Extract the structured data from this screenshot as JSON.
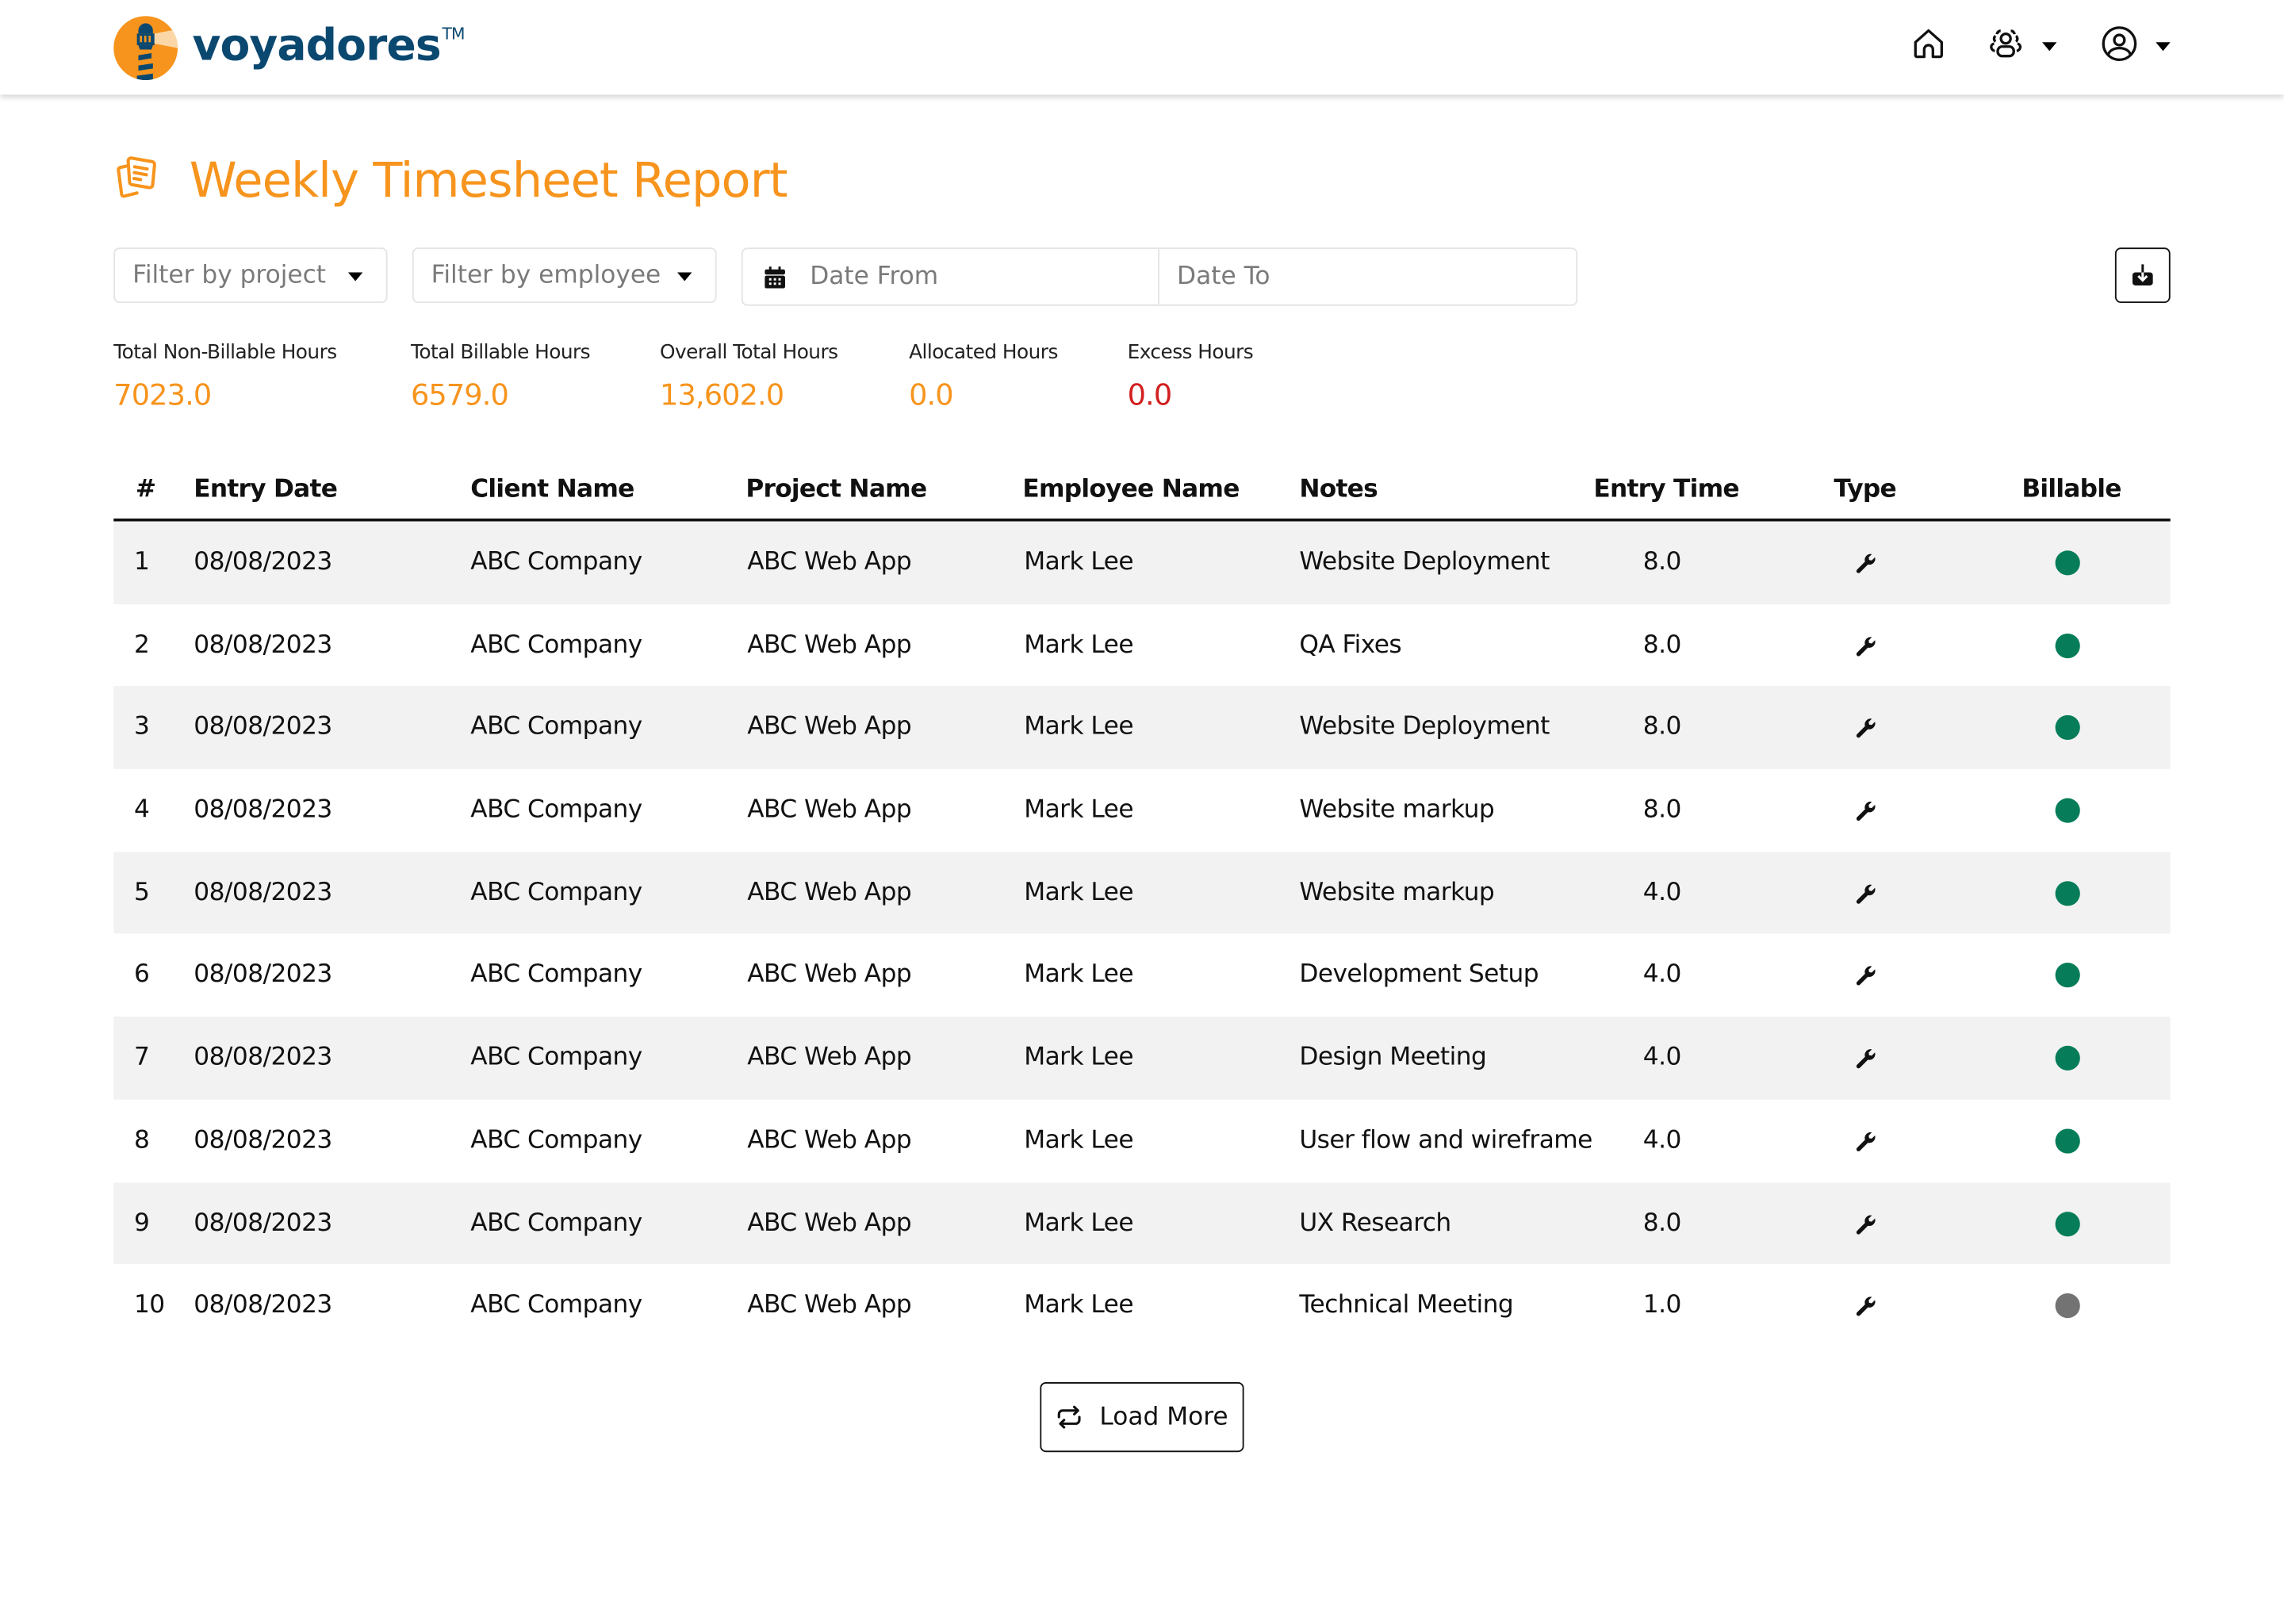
{
  "brand": {
    "name": "voyadores",
    "trademark": "TM",
    "primary_color": "#f7941d",
    "text_color": "#0b4870"
  },
  "nav": {
    "home_icon": "home-icon",
    "team_icon": "users-icon",
    "profile_icon": "user-circle-icon"
  },
  "page": {
    "title": "Weekly Timesheet Report",
    "title_icon": "documents-icon"
  },
  "filters": {
    "project_placeholder": "Filter by project",
    "employee_placeholder": "Filter by employee",
    "date_from_placeholder": "Date From",
    "date_to_placeholder": "Date To",
    "download_icon": "download-icon"
  },
  "stats": [
    {
      "label": "Total Non-Billable Hours",
      "value": "7023.0"
    },
    {
      "label": "Total Billable Hours",
      "value": "6579.0"
    },
    {
      "label": "Overall Total Hours",
      "value": "13,602.0"
    },
    {
      "label": "Allocated Hours",
      "value": "0.0"
    },
    {
      "label": "Excess Hours",
      "value": "0.0",
      "color": "#d21f1f"
    }
  ],
  "table": {
    "columns": [
      "#",
      "Entry Date",
      "Client Name",
      "Project Name",
      "Employee Name",
      "Notes",
      "Entry Time",
      "Type",
      "Billable"
    ],
    "rows": [
      {
        "num": "1",
        "date": "08/08/2023",
        "client": "ABC Company",
        "project": "ABC Web App",
        "employee": "Mark Lee",
        "notes": "Website Deployment",
        "time": "8.0",
        "type": "wrench-icon",
        "billable": true
      },
      {
        "num": "2",
        "date": "08/08/2023",
        "client": "ABC Company",
        "project": "ABC Web App",
        "employee": "Mark Lee",
        "notes": "QA Fixes",
        "time": "8.0",
        "type": "wrench-icon",
        "billable": true
      },
      {
        "num": "3",
        "date": "08/08/2023",
        "client": "ABC Company",
        "project": "ABC Web App",
        "employee": "Mark Lee",
        "notes": "Website Deployment",
        "time": "8.0",
        "type": "wrench-icon",
        "billable": true
      },
      {
        "num": "4",
        "date": "08/08/2023",
        "client": "ABC Company",
        "project": "ABC Web App",
        "employee": "Mark Lee",
        "notes": "Website markup",
        "time": "8.0",
        "type": "wrench-icon",
        "billable": true
      },
      {
        "num": "5",
        "date": "08/08/2023",
        "client": "ABC Company",
        "project": "ABC Web App",
        "employee": "Mark Lee",
        "notes": "Website markup",
        "time": "4.0",
        "type": "wrench-icon",
        "billable": true
      },
      {
        "num": "6",
        "date": "08/08/2023",
        "client": "ABC Company",
        "project": "ABC Web App",
        "employee": "Mark Lee",
        "notes": "Development Setup",
        "time": "4.0",
        "type": "wrench-icon",
        "billable": true
      },
      {
        "num": "7",
        "date": "08/08/2023",
        "client": "ABC Company",
        "project": "ABC Web App",
        "employee": "Mark Lee",
        "notes": "Design Meeting",
        "time": "4.0",
        "type": "wrench-icon",
        "billable": true
      },
      {
        "num": "8",
        "date": "08/08/2023",
        "client": "ABC Company",
        "project": "ABC Web App",
        "employee": "Mark Lee",
        "notes": "User flow and wireframe",
        "time": "4.0",
        "type": "wrench-icon",
        "billable": true
      },
      {
        "num": "9",
        "date": "08/08/2023",
        "client": "ABC Company",
        "project": "ABC Web App",
        "employee": "Mark Lee",
        "notes": "UX Research",
        "time": "8.0",
        "type": "wrench-icon",
        "billable": true
      },
      {
        "num": "10",
        "date": "08/08/2023",
        "client": "ABC Company",
        "project": "ABC Web App",
        "employee": "Mark Lee",
        "notes": "Technical Meeting",
        "time": "1.0",
        "type": "wrench-icon",
        "billable": false
      }
    ],
    "billable_color": "#067d58",
    "non_billable_color": "#737373"
  },
  "load_more": {
    "label": "Load More",
    "icon": "repeat-icon"
  }
}
